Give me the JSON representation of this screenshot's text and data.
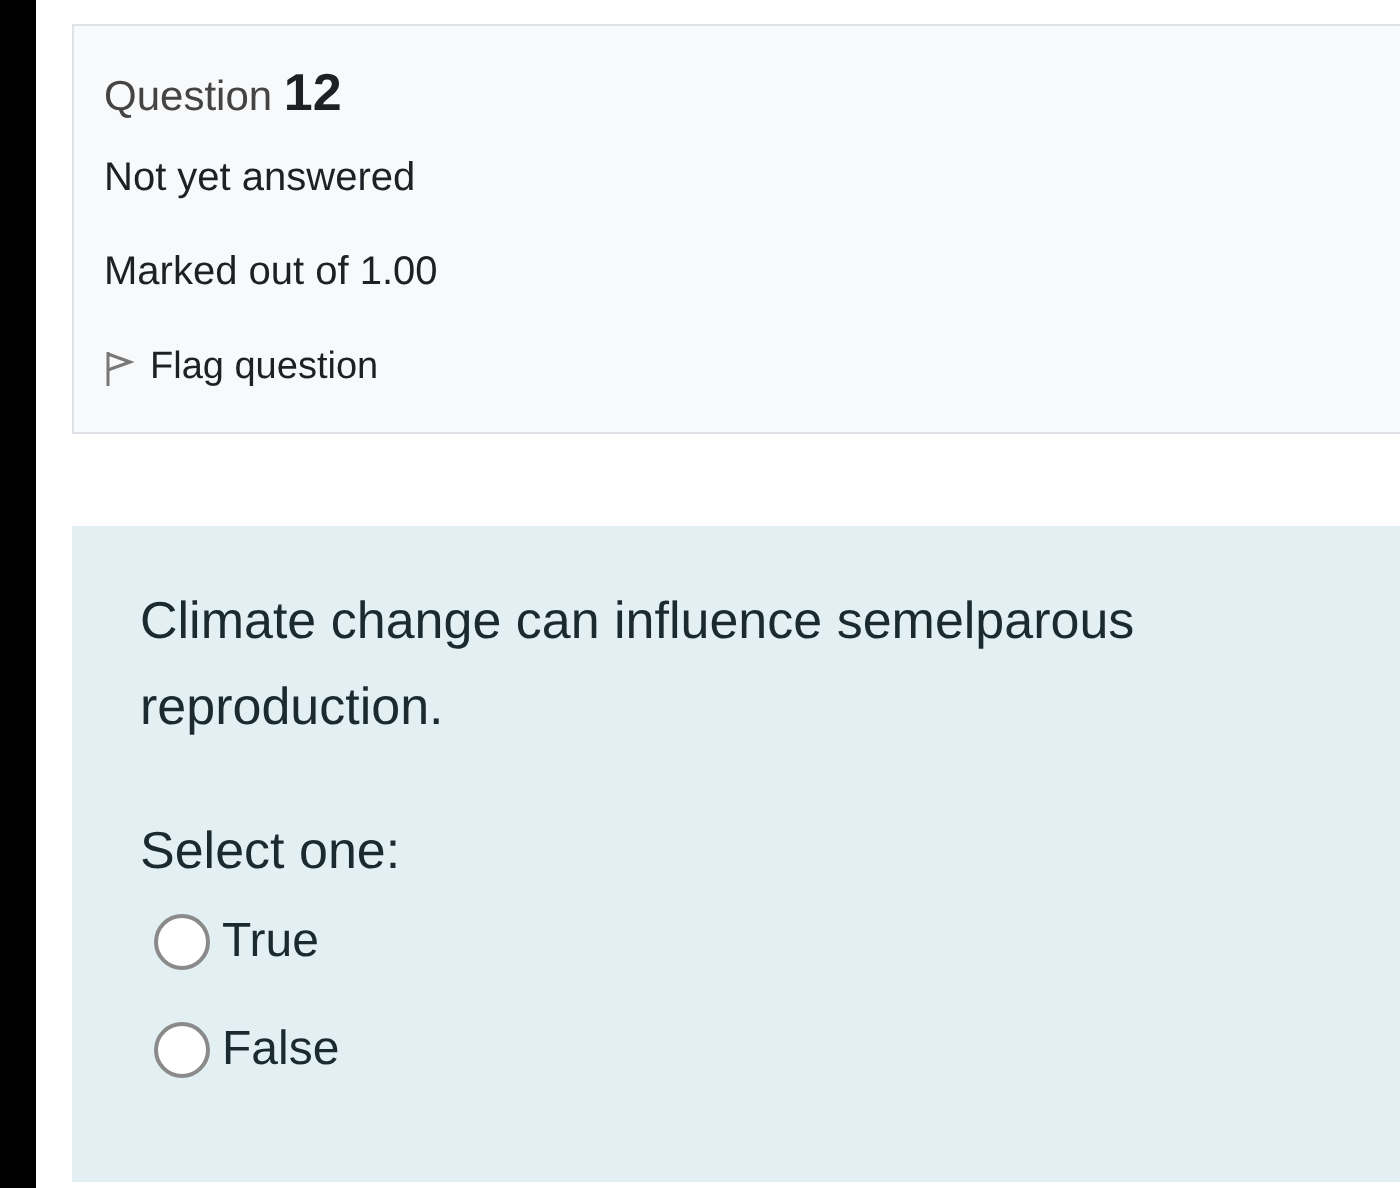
{
  "info": {
    "title": "Question **12**",
    "status": "Not yet answered",
    "mark": "Marked out of 1.00",
    "flag": {
      "label": "Flag question",
      "checked": false
    }
  },
  "question": {
    "text": "Climate change can influence semelparous reproduction.",
    "prompt": "Select one:",
    "options": [
      {
        "label": "True",
        "selected": false
      },
      {
        "label": "False",
        "selected": false
      }
    ]
  }
}
